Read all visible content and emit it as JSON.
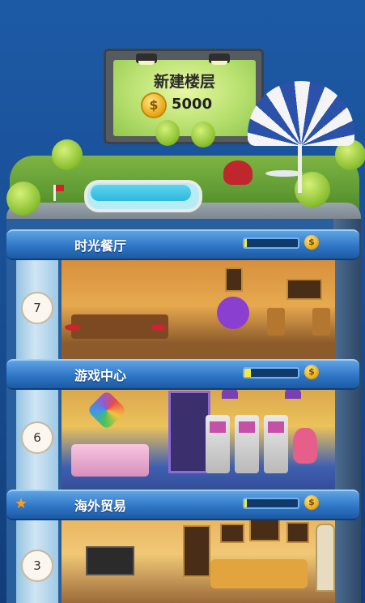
{
  "build_floor": {
    "title": "新建楼层",
    "cost": "5000",
    "coin_icon": "gold-coin-icon"
  },
  "floors": [
    {
      "number": "7",
      "name": "时光餐厅",
      "progress": 0.05
    },
    {
      "number": "6",
      "name": "游戏中心",
      "progress": 0.12
    },
    {
      "number": "3",
      "name": "海外贸易",
      "progress": 0.05
    }
  ],
  "colors": {
    "bar_blue": "#2f76c6",
    "progress_fill": "#f5e93a",
    "roof_green": "#5e9a33"
  }
}
